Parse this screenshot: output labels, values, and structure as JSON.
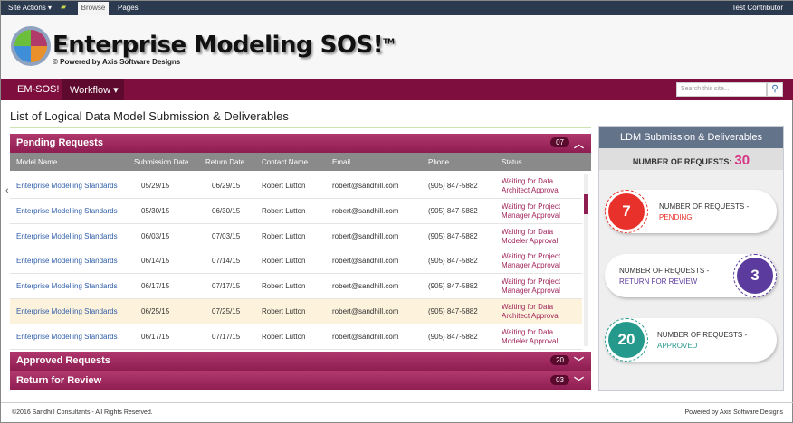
{
  "topbar": {
    "site_actions": "Site Actions ▾",
    "browse": "Browse",
    "pages": "Pages",
    "user": "Test Contributor"
  },
  "header": {
    "logo_text": "Enterprise Modeling SOS!",
    "tm": "TM",
    "subtitle": "© Powered by Axis Software Designs"
  },
  "nav": {
    "items": [
      "EM-SOS!",
      "Workflow ▾"
    ],
    "search_placeholder": "Search this site..."
  },
  "page_title": "List of Logical Data Model Submission & Deliverables",
  "pending": {
    "title": "Pending Requests",
    "count": "07",
    "columns": [
      "Model Name",
      "Submission Date",
      "Return Date",
      "Contact Name",
      "Email",
      "Phone",
      "Status"
    ],
    "rows": [
      [
        "Enterprise Modelling Standards",
        "05/29/15",
        "06/29/15",
        "Robert Lutton",
        "robert@sandhill.com",
        "(905) 847-5882",
        "Waiting for Data",
        "Architect Approval"
      ],
      [
        "Enterprise Modelling Standards",
        "05/30/15",
        "06/30/15",
        "Robert Lutton",
        "robert@sandhill.com",
        "(905) 847-5882",
        "Waiting for Project",
        "Manager Approval"
      ],
      [
        "Enterprise Modelling Standards",
        "06/03/15",
        "07/03/15",
        "Robert Lutton",
        "robert@sandhill.com",
        "(905) 847-5882",
        "Waiting for Data",
        "Modeler Approval"
      ],
      [
        "Enterprise Modelling Standards",
        "06/14/15",
        "07/14/15",
        "Robert Lutton",
        "robert@sandhill.com",
        "(905) 847-5882",
        "Waiting for Project",
        "Manager Approval"
      ],
      [
        "Enterprise Modelling Standards",
        "06/17/15",
        "07/17/15",
        "Robert Lutton",
        "robert@sandhill.com",
        "(905) 847-5882",
        "Waiting for Project",
        "Manager Approval"
      ],
      [
        "Enterprise Modelling Standards",
        "06/25/15",
        "07/25/15",
        "Robert Lutton",
        "robert@sandhill.com",
        "(905) 847-5882",
        "Waiting for Data",
        "Architect Approval"
      ],
      [
        "Enterprise Modelling Standards",
        "06/17/15",
        "07/17/15",
        "Robert Lutton",
        "robert@sandhill.com",
        "(905) 847-5882",
        "Waiting for Data",
        "Modeler Approval"
      ]
    ]
  },
  "approved": {
    "title": "Approved  Requests",
    "count": "20"
  },
  "returned": {
    "title": "Return for Review",
    "count": "03"
  },
  "side": {
    "title": "LDM Submission & Deliverables",
    "total_label": "NUMBER OF REQUESTS:",
    "total": "30",
    "cards": [
      {
        "value": "7",
        "label": "NUMBER OF REQUESTS -",
        "status": "PENDING",
        "color": "#e8312a"
      },
      {
        "value": "3",
        "label": "NUMBER OF REQUESTS -",
        "status": "RETURN FOR REVIEW",
        "color": "#5b3b9e"
      },
      {
        "value": "20",
        "label": "NUMBER OF REQUESTS -",
        "status": "APPROVED",
        "color": "#25998c"
      }
    ]
  },
  "footer": {
    "left": "©2016 Sandhill Consultants - All Rights Reserved.",
    "right": "Powered by Axis Software Designs"
  }
}
